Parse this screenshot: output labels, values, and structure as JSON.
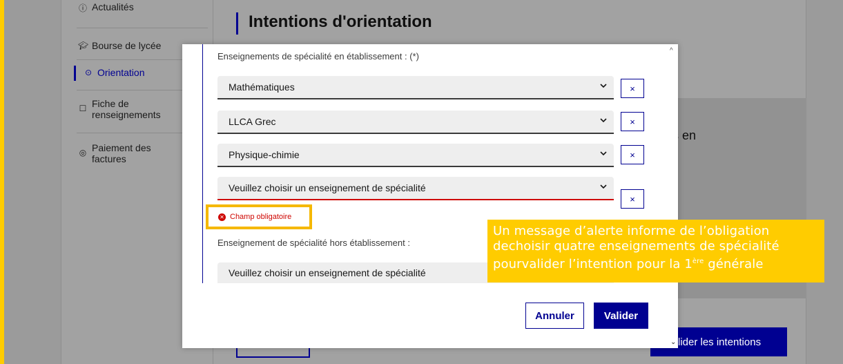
{
  "sidebar": {
    "items": [
      {
        "icon": "info-icon",
        "label": "Actualités"
      },
      {
        "icon": "graduation-icon",
        "label": "Bourse de lycée"
      },
      {
        "icon": "compass-icon",
        "label": "Orientation"
      },
      {
        "icon": "form-icon",
        "label_line1": "Fiche de",
        "label_line2": "renseignements"
      },
      {
        "icon": "coin-icon",
        "label_line1": "Paiement des",
        "label_line2": "factures"
      }
    ]
  },
  "page": {
    "title": "Intentions d'orientation",
    "card_text_fragment": "s en",
    "submit_button_fragment": "lider les intentions"
  },
  "modal": {
    "in_school_label": "Enseignements de spécialité en établissement : (*)",
    "selects": [
      {
        "value": "Mathématiques"
      },
      {
        "value": "LLCA Grec"
      },
      {
        "value": "Physique-chimie"
      },
      {
        "value": "Veuillez choisir un enseignement de spécialité",
        "error": true
      }
    ],
    "remove_label": "×",
    "error_message": "Champ obligatoire",
    "outside_label": "Enseignement de spécialité hors établissement :",
    "outside_select": {
      "value": "Veuillez choisir un enseignement de spécialité"
    },
    "cancel_label": "Annuler",
    "validate_label": "Valider"
  },
  "annotation": {
    "line1": "Un message d’alerte informe de l’obligation",
    "line2": "dechoisir quatre enseignements de spécialité",
    "line3_prefix": "pourvalider l’intention pour la 1",
    "line3_sup": "ère",
    "line3_suffix": " générale"
  },
  "colors": {
    "accent": "#000091",
    "highlight": "#ffcc00",
    "error": "#ce0500"
  }
}
